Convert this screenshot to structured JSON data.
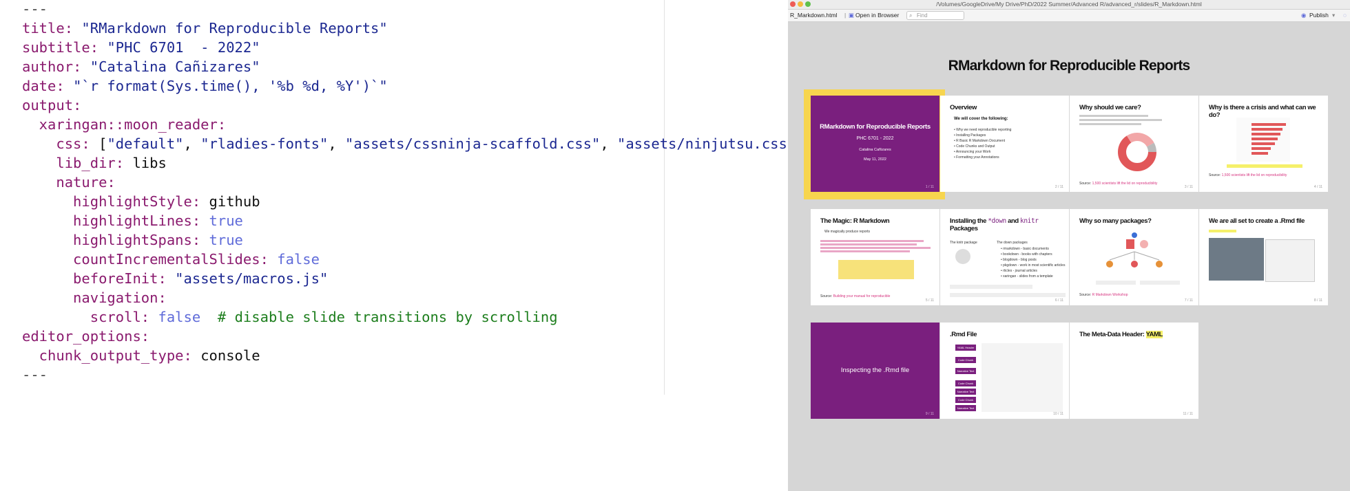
{
  "editor": {
    "lines": [
      [
        {
          "t": "---",
          "c": "p"
        }
      ],
      [
        {
          "t": "title: ",
          "c": "k"
        },
        {
          "t": "\"RMarkdown for Reproducible Reports\"",
          "c": "s"
        }
      ],
      [
        {
          "t": "subtitle: ",
          "c": "k"
        },
        {
          "t": "\"PHC 6701  - 2022\"",
          "c": "s"
        }
      ],
      [
        {
          "t": "author: ",
          "c": "k"
        },
        {
          "t": "\"Catalina Cañizares\"",
          "c": "s"
        }
      ],
      [
        {
          "t": "date: ",
          "c": "k"
        },
        {
          "t": "\"`r format(Sys.time(), '%b %d, %Y')`\"",
          "c": "s"
        }
      ],
      [
        {
          "t": "output:",
          "c": "k"
        }
      ],
      [
        {
          "t": "  xaringan::moon_reader:",
          "c": "k"
        }
      ],
      [
        {
          "t": "    css: ",
          "c": "k"
        },
        {
          "t": "[",
          "c": "v"
        },
        {
          "t": "\"default\"",
          "c": "s"
        },
        {
          "t": ", ",
          "c": "v"
        },
        {
          "t": "\"rladies-fonts\"",
          "c": "s"
        },
        {
          "t": ", ",
          "c": "v"
        },
        {
          "t": "\"assets/cssninja-scaffold.css\"",
          "c": "s"
        },
        {
          "t": ", ",
          "c": "v"
        },
        {
          "t": "\"assets/ninjutsu.css\"",
          "c": "s"
        },
        {
          "t": "]",
          "c": "v"
        }
      ],
      [
        {
          "t": "    lib_dir: ",
          "c": "k"
        },
        {
          "t": "libs",
          "c": "v"
        }
      ],
      [
        {
          "t": "    nature:",
          "c": "k"
        }
      ],
      [
        {
          "t": "      highlightStyle: ",
          "c": "k"
        },
        {
          "t": "github",
          "c": "v"
        }
      ],
      [
        {
          "t": "      highlightLines: ",
          "c": "k"
        },
        {
          "t": "true",
          "c": "b"
        }
      ],
      [
        {
          "t": "      highlightSpans: ",
          "c": "k"
        },
        {
          "t": "true",
          "c": "b"
        }
      ],
      [
        {
          "t": "      countIncrementalSlides: ",
          "c": "k"
        },
        {
          "t": "false",
          "c": "b"
        }
      ],
      [
        {
          "t": "      beforeInit: ",
          "c": "k"
        },
        {
          "t": "\"assets/macros.js\"",
          "c": "s"
        }
      ],
      [
        {
          "t": "      navigation:",
          "c": "k"
        }
      ],
      [
        {
          "t": "        scroll: ",
          "c": "k"
        },
        {
          "t": "false",
          "c": "b"
        },
        {
          "t": "  # disable slide transitions by scrolling",
          "c": "c"
        }
      ],
      [
        {
          "t": "editor_options:",
          "c": "k"
        }
      ],
      [
        {
          "t": "  chunk_output_type: ",
          "c": "k"
        },
        {
          "t": "console",
          "c": "v"
        }
      ],
      [
        {
          "t": "---",
          "c": "p"
        }
      ]
    ]
  },
  "viewer": {
    "window_title": "/Volumes/GoogleDrive/My Drive/PhD/2022 Summer/Advanced R/advanced_r/slides/R_Markdown.html",
    "tab_label": "R_Markdown.html",
    "open_in_browser_label": "Open in Browser",
    "find_placeholder": "Find",
    "publish_label": "Publish",
    "doc_title": "RMarkdown for Reproducible Reports",
    "colors": {
      "accent": "#7a1f7e",
      "selection": "#f7d54e",
      "link": "#d6337f"
    },
    "slides": [
      {
        "title": "RMarkdown for Reproducible Reports",
        "subtitle": "PHC 6701 - 2022",
        "author": "Catalina Cañizares",
        "date": "May 11, 2022",
        "page": "1 / 11"
      },
      {
        "title": "Overview",
        "subtitle": "We will cover the following:",
        "bullets": [
          "Why we need reproducible reporting",
          "Installing Packages",
          "R Basic R Markdown Document",
          "Code Chunks and Output",
          "Announcing your Work",
          "Formatting your Annotations"
        ],
        "page": "2 / 11"
      },
      {
        "title": "Why should we care?",
        "source_label": "Source:",
        "source_link": "1,500 scientists lift the lid on reproducibility",
        "page": "3 / 11"
      },
      {
        "title": "Why is there a crisis and what can we do?",
        "source_label": "Source:",
        "source_link": "1,500 scientists lift the lid on reproducibility",
        "page": "4 / 11"
      },
      {
        "title": "The Magic: R Markdown",
        "subtitle": "We magically produce reports",
        "source_label": "Source:",
        "source_link": "Building your manual for reproducible",
        "page": "5 / 11"
      },
      {
        "title_a": "Installing the ",
        "title_b": "*down",
        "title_c": " and ",
        "title_d": "knitr",
        "title_e": "Packages",
        "left_head": "The knitr package",
        "right_head": "The down packages",
        "bullets": [
          "rmarkdown - basic documents",
          "bookdown - books with chapters",
          "blogdown - blog posts",
          "pkgdown - work in most scientific articles",
          "rticles - journal articles",
          "xaringan - slides from a template"
        ],
        "page": "6 / 11"
      },
      {
        "title": "Why so many packages?",
        "source_label": "Source:",
        "source_link": "R Markdown Workshop",
        "page": "7 / 11"
      },
      {
        "title": "We are all set to create a .Rmd file",
        "page": "8 / 11"
      },
      {
        "title": "Inspecting the .Rmd file",
        "page": "9 / 11"
      },
      {
        "title": ".Rmd File",
        "labels": [
          "YAML Header",
          "Code Chunk",
          "Narrative Text",
          "Code Chunk",
          "Narrative Text",
          "Code Chunk",
          "Narrative Text"
        ],
        "page": "10 / 11"
      },
      {
        "title_a": "The Meta-Data Header: ",
        "title_b": "YAML",
        "page": "11 / 11"
      }
    ]
  }
}
